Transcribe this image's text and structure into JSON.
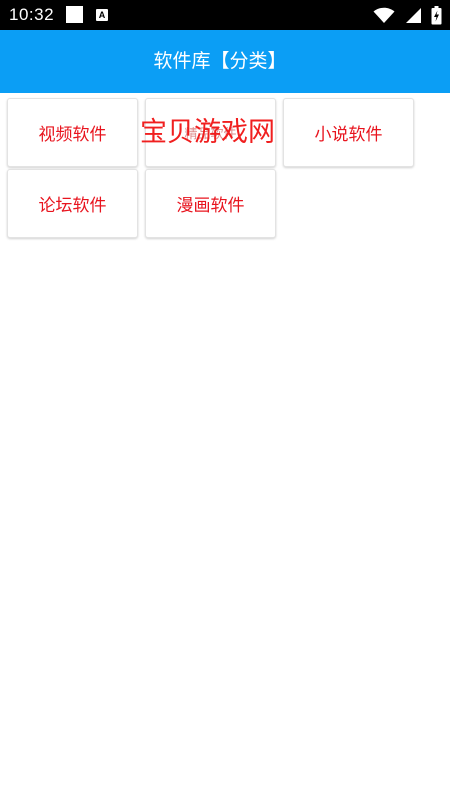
{
  "status_bar": {
    "time": "10:32",
    "icons": [
      "notification-square-icon",
      "notification-a-icon",
      "wifi-icon",
      "signal-icon",
      "battery-charging-icon"
    ],
    "notif_letter": "A"
  },
  "app_bar": {
    "title": "软件库【分类】",
    "color": "#0b9ef5"
  },
  "categories": [
    {
      "label": "视频软件"
    },
    {
      "label": "精品软件"
    },
    {
      "label": "小说软件"
    },
    {
      "label": "论坛软件"
    },
    {
      "label": "漫画软件"
    }
  ],
  "watermark": {
    "text": "宝贝游戏网"
  },
  "colors": {
    "label_red": "#e8141e",
    "watermark_red": "#f01414"
  }
}
